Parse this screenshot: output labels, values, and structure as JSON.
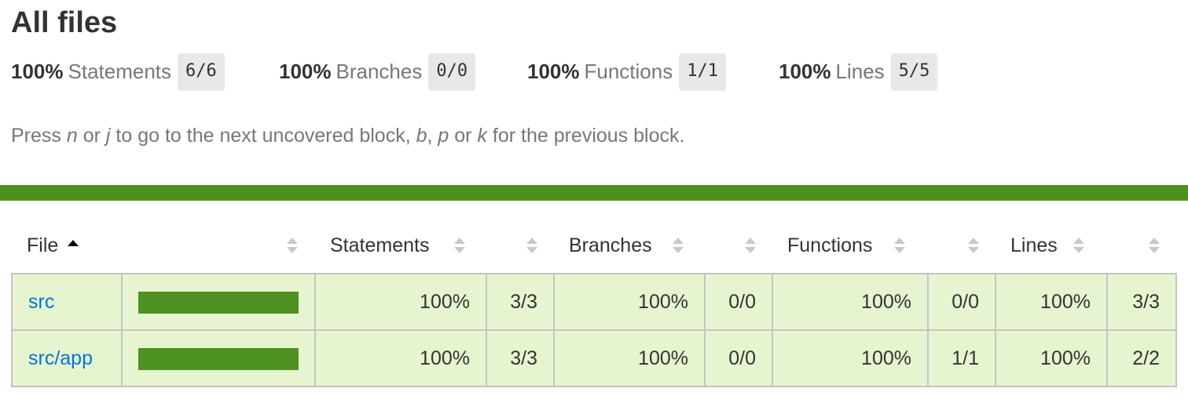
{
  "page": {
    "title": "All files"
  },
  "summary": [
    {
      "pct": "100%",
      "label": "Statements",
      "fraction": "6/6"
    },
    {
      "pct": "100%",
      "label": "Branches",
      "fraction": "0/0"
    },
    {
      "pct": "100%",
      "label": "Functions",
      "fraction": "1/1"
    },
    {
      "pct": "100%",
      "label": "Lines",
      "fraction": "5/5"
    }
  ],
  "help": {
    "t1": "Press ",
    "k1": "n",
    "t2": " or ",
    "k2": "j",
    "t3": " to go to the next uncovered block, ",
    "k3": "b",
    "t4": ", ",
    "k4": "p",
    "t5": " or ",
    "k5": "k",
    "t6": " for the previous block."
  },
  "status_color": "#4d9221",
  "table": {
    "headers": {
      "file": "File",
      "statements": "Statements",
      "branches": "Branches",
      "functions": "Functions",
      "lines": "Lines"
    },
    "sorted_column": "file",
    "sort_direction": "ascending",
    "rows": [
      {
        "file": "src",
        "coverage": 1.0,
        "statements_pct": "100%",
        "statements_frac": "3/3",
        "branches_pct": "100%",
        "branches_frac": "0/0",
        "functions_pct": "100%",
        "functions_frac": "0/0",
        "lines_pct": "100%",
        "lines_frac": "3/3"
      },
      {
        "file": "src/app",
        "coverage": 1.0,
        "statements_pct": "100%",
        "statements_frac": "3/3",
        "branches_pct": "100%",
        "branches_frac": "0/0",
        "functions_pct": "100%",
        "functions_frac": "1/1",
        "lines_pct": "100%",
        "lines_frac": "2/2"
      }
    ]
  }
}
